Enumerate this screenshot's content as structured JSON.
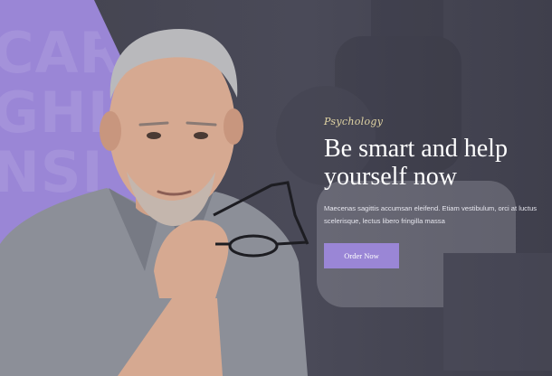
{
  "hero": {
    "background_words": [
      "CAR",
      "GHL",
      "NSI"
    ],
    "eyebrow": "Psychology",
    "headline": "Be smart and help yourself now",
    "description": "Maecenas sagittis accumsan eleifend. Etiam vestibulum, orci at luctus scelerisque, lectus libero fringilla massa",
    "cta_label": "Order Now"
  },
  "colors": {
    "accent_purple": "#9a86d6",
    "dark_background": "#45454f",
    "eyebrow_gold": "#e2d5a4",
    "text_white": "#ffffff"
  }
}
